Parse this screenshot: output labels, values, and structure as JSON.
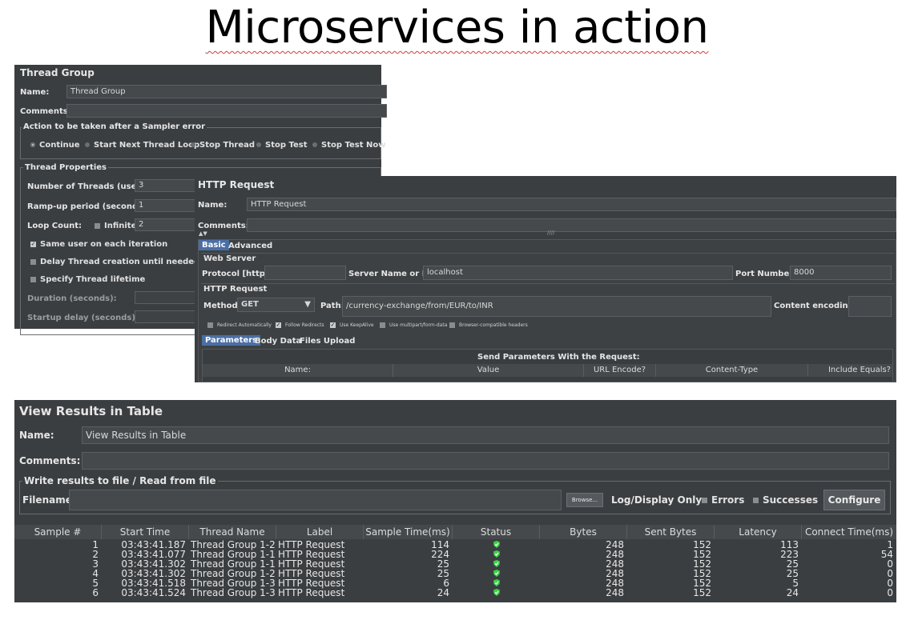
{
  "slide_title": "Microservices in action",
  "thread_group": {
    "title": "Thread Group",
    "name_label": "Name:",
    "name_value": "Thread Group",
    "comments_label": "Comments:",
    "comments_value": "",
    "error_action_title": "Action to be taken after a Sampler error",
    "error_actions": [
      "Continue",
      "Start Next Thread Loop",
      "Stop Thread",
      "Stop Test",
      "Stop Test Now"
    ],
    "selected_action": "Continue",
    "properties_title": "Thread Properties",
    "threads_label": "Number of Threads (users):",
    "threads_value": "3",
    "rampup_label": "Ramp-up period (seconds):",
    "rampup_value": "1",
    "loop_label": "Loop Count:",
    "infinite_label": "Infinite",
    "loop_value": "2",
    "same_user_label": "Same user on each iteration",
    "delay_label": "Delay Thread creation until needed",
    "lifetime_label": "Specify Thread lifetime",
    "duration_label": "Duration (seconds):",
    "startup_label": "Startup delay (seconds):"
  },
  "http_request": {
    "title": "HTTP Request",
    "name_label": "Name:",
    "name_value": "HTTP Request",
    "comments_label": "Comments:",
    "tabs": [
      "Basic",
      "Advanced"
    ],
    "web_server_title": "Web Server",
    "protocol_label": "Protocol [http]:",
    "protocol_value": "",
    "server_label": "Server Name or IP:",
    "server_value": "localhost",
    "port_label": "Port Number:",
    "port_value": "8000",
    "http_section_title": "HTTP Request",
    "method_label": "Method:",
    "method_value": "GET",
    "path_label": "Path:",
    "path_value": "/currency-exchange/from/EUR/to/INR",
    "encoding_label": "Content encoding:",
    "options": [
      "Redirect Automatically",
      "Follow Redirects",
      "Use KeepAlive",
      "Use multipart/form-data",
      "Browser-compatible headers"
    ],
    "sub_tabs": [
      "Parameters",
      "Body Data",
      "Files Upload"
    ],
    "params_title": "Send Parameters With the Request:",
    "param_columns": [
      "Name:",
      "Value",
      "URL Encode?",
      "Content-Type",
      "Include Equals?"
    ]
  },
  "view_results": {
    "title": "View Results in Table",
    "name_label": "Name:",
    "name_value": "View Results in Table",
    "comments_label": "Comments:",
    "write_title": "Write results to file / Read from file",
    "filename_label": "Filename",
    "browse_label": "Browse...",
    "log_display_label": "Log/Display Only:",
    "errors_label": "Errors",
    "successes_label": "Successes",
    "configure_label": "Configure",
    "columns": [
      "Sample #",
      "Start Time",
      "Thread Name",
      "Label",
      "Sample Time(ms)",
      "Status",
      "Bytes",
      "Sent Bytes",
      "Latency",
      "Connect Time(ms)"
    ],
    "rows": [
      {
        "n": "1",
        "start": "03:43:41.187",
        "thread": "Thread Group 1-2",
        "label": "HTTP Request",
        "time": "114",
        "bytes": "248",
        "sent": "152",
        "latency": "113",
        "connect": "1"
      },
      {
        "n": "2",
        "start": "03:43:41.077",
        "thread": "Thread Group 1-1",
        "label": "HTTP Request",
        "time": "224",
        "bytes": "248",
        "sent": "152",
        "latency": "223",
        "connect": "54"
      },
      {
        "n": "3",
        "start": "03:43:41.302",
        "thread": "Thread Group 1-1",
        "label": "HTTP Request",
        "time": "25",
        "bytes": "248",
        "sent": "152",
        "latency": "25",
        "connect": "0"
      },
      {
        "n": "4",
        "start": "03:43:41.302",
        "thread": "Thread Group 1-2",
        "label": "HTTP Request",
        "time": "25",
        "bytes": "248",
        "sent": "152",
        "latency": "25",
        "connect": "0"
      },
      {
        "n": "5",
        "start": "03:43:41.518",
        "thread": "Thread Group 1-3",
        "label": "HTTP Request",
        "time": "6",
        "bytes": "248",
        "sent": "152",
        "latency": "5",
        "connect": "0"
      },
      {
        "n": "6",
        "start": "03:43:41.524",
        "thread": "Thread Group 1-3",
        "label": "HTTP Request",
        "time": "24",
        "bytes": "248",
        "sent": "152",
        "latency": "24",
        "connect": "0"
      }
    ],
    "status_icon": "success-shield-icon",
    "status_color": "#3fd14a"
  }
}
